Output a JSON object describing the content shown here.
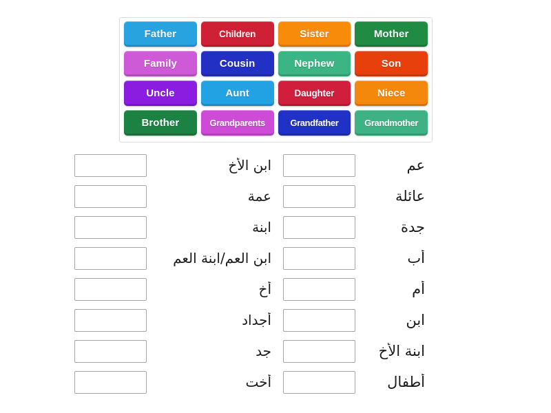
{
  "tile_bank": {
    "rows": [
      [
        {
          "label": "Father",
          "color": "#29a3e0"
        },
        {
          "label": "Children",
          "color": "#cf2135"
        },
        {
          "label": "Sister",
          "color": "#f98b0b"
        },
        {
          "label": "Mother",
          "color": "#1f8b43"
        }
      ],
      [
        {
          "label": "Family",
          "color": "#cf5ad8"
        },
        {
          "label": "Cousin",
          "color": "#2330c4"
        },
        {
          "label": "Nephew",
          "color": "#3bb583"
        },
        {
          "label": "Son",
          "color": "#e8400d"
        }
      ],
      [
        {
          "label": "Uncle",
          "color": "#8b1de0"
        },
        {
          "label": "Aunt",
          "color": "#22a2e2"
        },
        {
          "label": "Daughter",
          "color": "#cf1f3c"
        },
        {
          "label": "Niece",
          "color": "#f4880c"
        }
      ],
      [
        {
          "label": "Brother",
          "color": "#1c8244"
        },
        {
          "label": "Grandparents",
          "color": "#cd4bd6"
        },
        {
          "label": "Grandfather",
          "color": "#2032c6"
        },
        {
          "label": "Grandmother",
          "color": "#3eb284"
        }
      ]
    ]
  },
  "answers": {
    "left_column": [
      {
        "label": "ابن الأخ"
      },
      {
        "label": "عمة"
      },
      {
        "label": "ابنة"
      },
      {
        "label": "ابن العم/ابنة العم"
      },
      {
        "label": "أخ"
      },
      {
        "label": "أجداد"
      },
      {
        "label": "جد"
      },
      {
        "label": "أخت"
      }
    ],
    "right_column": [
      {
        "label": "عم"
      },
      {
        "label": "عائلة"
      },
      {
        "label": "جدة"
      },
      {
        "label": "أب"
      },
      {
        "label": "أم"
      },
      {
        "label": "ابن"
      },
      {
        "label": "ابنة الأخ"
      },
      {
        "label": "أطفال"
      }
    ]
  }
}
